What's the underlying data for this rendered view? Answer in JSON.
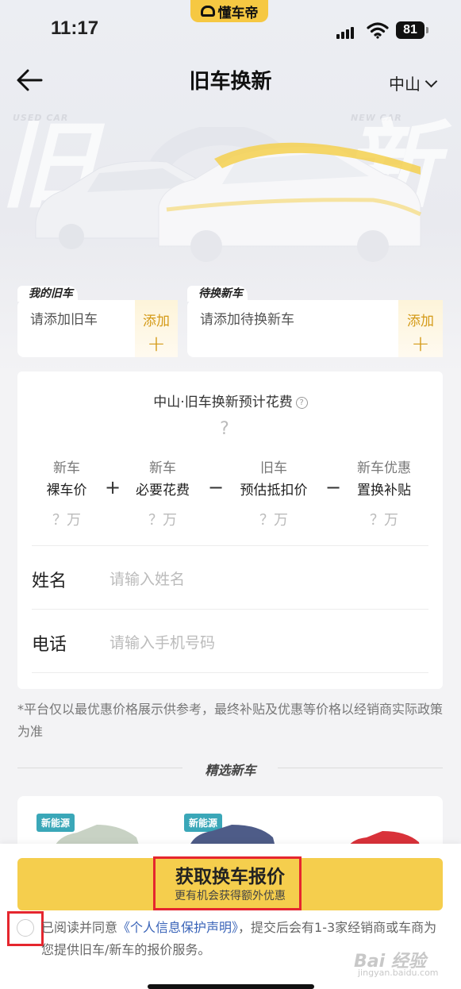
{
  "status_bar": {
    "time": "11:17",
    "app_badge": "懂车帝",
    "battery": "81"
  },
  "nav": {
    "title": "旧车换新",
    "city": "中山"
  },
  "hero": {
    "used_label": "USED CAR",
    "new_label": "NEW CAR",
    "old_char": "旧",
    "new_char": "新"
  },
  "old_car_card": {
    "tag": "我的旧车",
    "placeholder": "请添加旧车",
    "add_label": "添加"
  },
  "new_car_card": {
    "tag": "待换新车",
    "placeholder": "请添加待换新车",
    "add_label": "添加"
  },
  "estimate": {
    "title": "中山·旧车换新预计花费",
    "total": "?",
    "columns": [
      {
        "line1": "新车",
        "line2": "裸车价",
        "value": "？万"
      },
      {
        "line1": "新车",
        "line2": "必要花费",
        "value": "？万"
      },
      {
        "line1": "旧车",
        "line2": "预估抵扣价",
        "value": "？万"
      },
      {
        "line1": "新车优惠",
        "line2": "置换补贴",
        "value": "？万"
      }
    ],
    "operators": [
      "+",
      "−",
      "−"
    ]
  },
  "form": {
    "name_label": "姓名",
    "name_placeholder": "请输入姓名",
    "phone_label": "电话",
    "phone_placeholder": "请输入手机号码"
  },
  "disclaimer": "*平台仅以最优惠价格展示供参考，最终补贴及优惠等价格以经销商实际政策为准",
  "featured": {
    "title": "精选新车",
    "tags": [
      "新能源",
      "新能源"
    ]
  },
  "cta": {
    "main": "获取换车报价",
    "sub": "更有机会获得额外优惠"
  },
  "agreement": {
    "prefix": "已阅读并同意",
    "link": "《个人信息保护声明》",
    "suffix": "，提交后会有1-3家经销商或车商为您提供旧车/新车的报价服务。"
  },
  "watermark": {
    "main": "Bai 经验",
    "sub": "jingyan.baidu.com"
  },
  "colors": {
    "accent": "#f5ce4d",
    "highlight": "#e5262e",
    "link": "#3a64b8",
    "nev_tag": "#3aa7b8"
  }
}
